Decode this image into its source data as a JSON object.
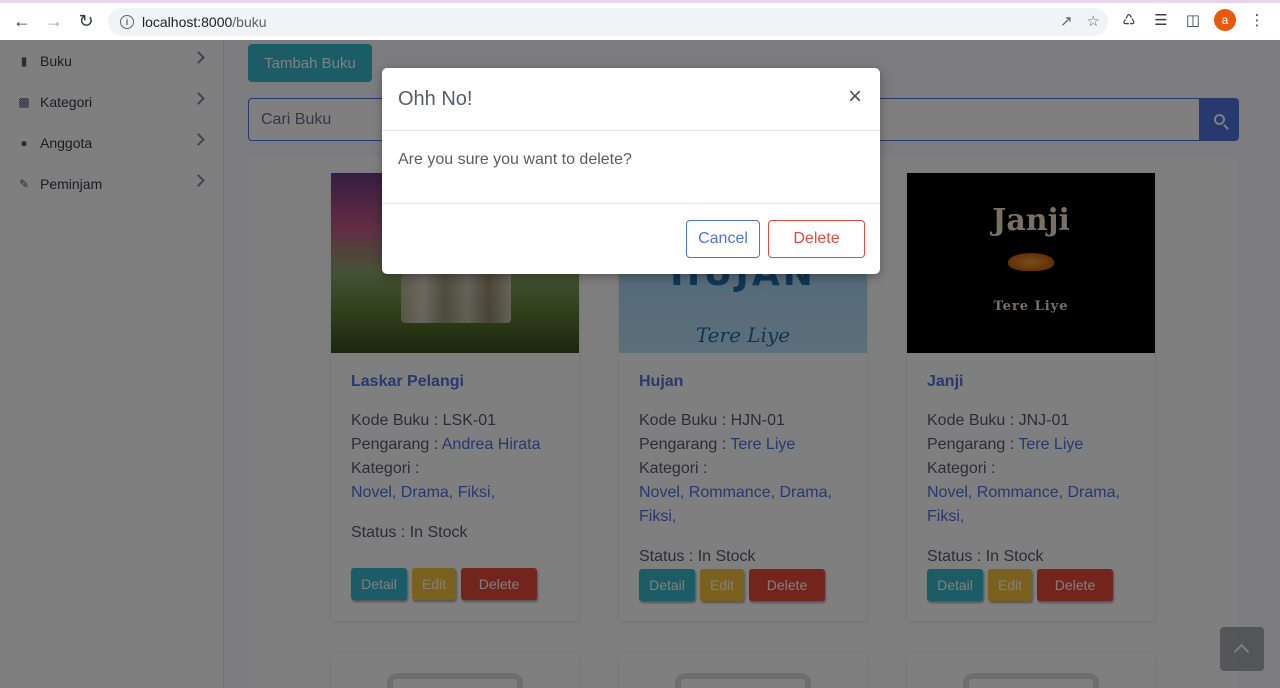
{
  "browser": {
    "url_host": "localhost:8000",
    "url_path": "/buku",
    "profile_initial": "a"
  },
  "sidebar": {
    "items": [
      {
        "label": "Buku",
        "icon": "book-icon"
      },
      {
        "label": "Kategori",
        "icon": "book-open-icon"
      },
      {
        "label": "Anggota",
        "icon": "users-icon"
      },
      {
        "label": "Peminjam",
        "icon": "user-edit-icon"
      }
    ]
  },
  "toolbar": {
    "add_label": "Tambah Buku",
    "search_placeholder": "Cari Buku"
  },
  "labels": {
    "kode": "Kode Buku : ",
    "pengarang": "Pengarang : ",
    "kategori": "Kategori :",
    "status": "Status : ",
    "detail": "Detail",
    "edit": "Edit",
    "delete": "Delete"
  },
  "books": [
    {
      "title": "Laskar Pelangi",
      "kode": "LSK-01",
      "pengarang": "Andrea Hirata",
      "kategori_line1": "Novel, Drama, Fiksi,",
      "kategori_line2": "",
      "status": "In Stock"
    },
    {
      "title": "Hujan",
      "kode": "HJN-01",
      "pengarang": "Tere Liye",
      "kategori_line1": "Novel, Rommance, Drama,",
      "kategori_line2": "Fiksi,",
      "status": "In Stock",
      "cover_title": "HUJAN",
      "cover_author": "Tere Liye"
    },
    {
      "title": "Janji",
      "kode": "JNJ-01",
      "pengarang": "Tere Liye",
      "kategori_line1": "Novel, Rommance, Drama,",
      "kategori_line2": "Fiksi,",
      "status": "In Stock",
      "cover_title": "Janji",
      "cover_author": "Tere Liye"
    }
  ],
  "modal": {
    "title": "Ohh No!",
    "close": "×",
    "message": "Are you sure you want to delete?",
    "cancel": "Cancel",
    "confirm": "Delete"
  },
  "colors": {
    "primary": "#4e73df",
    "info": "#36b9cc",
    "warning": "#f6c23e",
    "danger": "#e74a3b"
  }
}
